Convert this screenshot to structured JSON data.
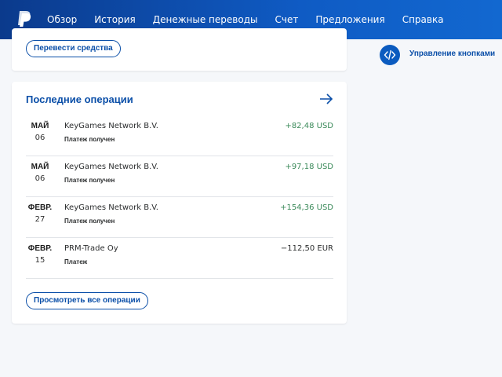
{
  "header": {
    "nav": [
      "Обзор",
      "История",
      "Денежные переводы",
      "Счет",
      "Предложения",
      "Справка"
    ],
    "active_index": 0
  },
  "transfer_card": {
    "button_label": "Перевести средства"
  },
  "operations": {
    "title": "Последние операции",
    "items": [
      {
        "month": "МАЙ",
        "day": "06",
        "name": "KeyGames Network B.V.",
        "status": "Платеж получен",
        "amount": "+82,48 USD",
        "direction": "in"
      },
      {
        "month": "МАЙ",
        "day": "06",
        "name": "KeyGames Network B.V.",
        "status": "Платеж получен",
        "amount": "+97,18 USD",
        "direction": "in"
      },
      {
        "month": "ФЕВР.",
        "day": "27",
        "name": "KeyGames Network B.V.",
        "status": "Платеж получен",
        "amount": "+154,36 USD",
        "direction": "in"
      },
      {
        "month": "ФЕВР.",
        "day": "15",
        "name": "PRM-Trade Oy",
        "status": "Платеж",
        "amount": "−112,50 EUR",
        "direction": "out"
      }
    ],
    "view_all_label": "Просмотреть все операции"
  },
  "sidebar": {
    "manage_buttons_label": "Управление кнопками"
  },
  "colors": {
    "brand_blue": "#0b4fa8",
    "positive_green": "#3b8a5a"
  }
}
